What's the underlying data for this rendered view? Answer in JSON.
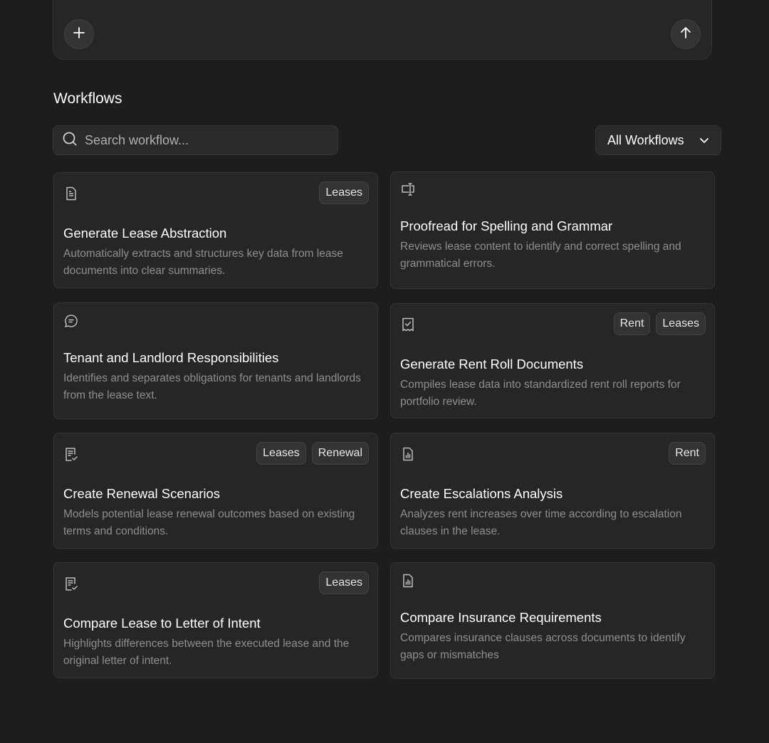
{
  "composer": {
    "add_icon": "plus-icon",
    "send_icon": "arrow-up-icon"
  },
  "workflows": {
    "title": "Workflows",
    "search_placeholder": "Search workflow...",
    "filter_label": "All Workflows",
    "cards": [
      {
        "icon": "document-icon",
        "tags": [
          "Leases"
        ],
        "title": "Generate Lease Abstraction",
        "description": "Automatically extracts and structures key data from lease documents into clear summaries."
      },
      {
        "icon": "text-cursor-icon",
        "tags": [],
        "title": "Proofread for Spelling and Grammar",
        "description": "Reviews lease content to identify and correct spelling and grammatical errors."
      },
      {
        "icon": "chat-bubble-icon",
        "tags": [],
        "title": "Tenant and Landlord Responsibilities",
        "description": "Identifies and separates obligations for tenants and landlords from the lease text."
      },
      {
        "icon": "receipt-check-icon",
        "tags": [
          "Rent",
          "Leases"
        ],
        "title": "Generate Rent Roll Documents",
        "description": "Compiles lease data into standardized rent roll reports for portfolio review."
      },
      {
        "icon": "document-check-icon",
        "tags": [
          "Leases",
          "Renewal"
        ],
        "title": "Create Renewal Scenarios",
        "description": "Models potential lease renewal outcomes based on existing terms and conditions."
      },
      {
        "icon": "document-chart-icon",
        "tags": [
          "Rent"
        ],
        "title": "Create Escalations Analysis",
        "description": "Analyzes rent increases over time according to escalation clauses in the lease."
      },
      {
        "icon": "document-check-icon",
        "tags": [
          "Leases"
        ],
        "title": "Compare Lease to Letter of Intent",
        "description": "Highlights differences between the executed lease and the original letter of intent."
      },
      {
        "icon": "document-chart-icon",
        "tags": [],
        "title": "Compare Insurance Requirements",
        "description": "Compares insurance clauses across documents to identify gaps or mismatches"
      }
    ]
  }
}
